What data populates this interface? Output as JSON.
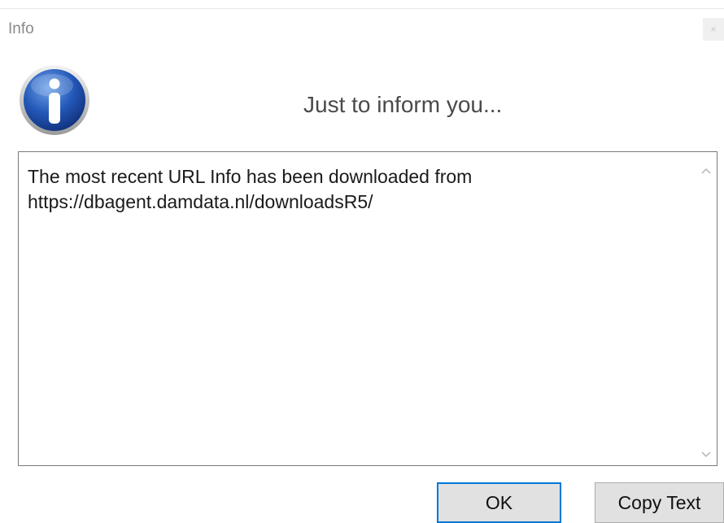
{
  "window": {
    "title": "Info",
    "close_glyph": "×"
  },
  "dialog": {
    "icon": "info-icon",
    "header": "Just to inform you...",
    "message": "The most recent URL Info has been downloaded from\nhttps://dbagent.damdata.nl/downloadsR5/"
  },
  "buttons": {
    "ok_label": "OK",
    "copy_label": "Copy Text"
  },
  "colors": {
    "accent": "#0078d7",
    "icon_blue": "#1d4fa8",
    "button_bg": "#e1e1e1"
  }
}
